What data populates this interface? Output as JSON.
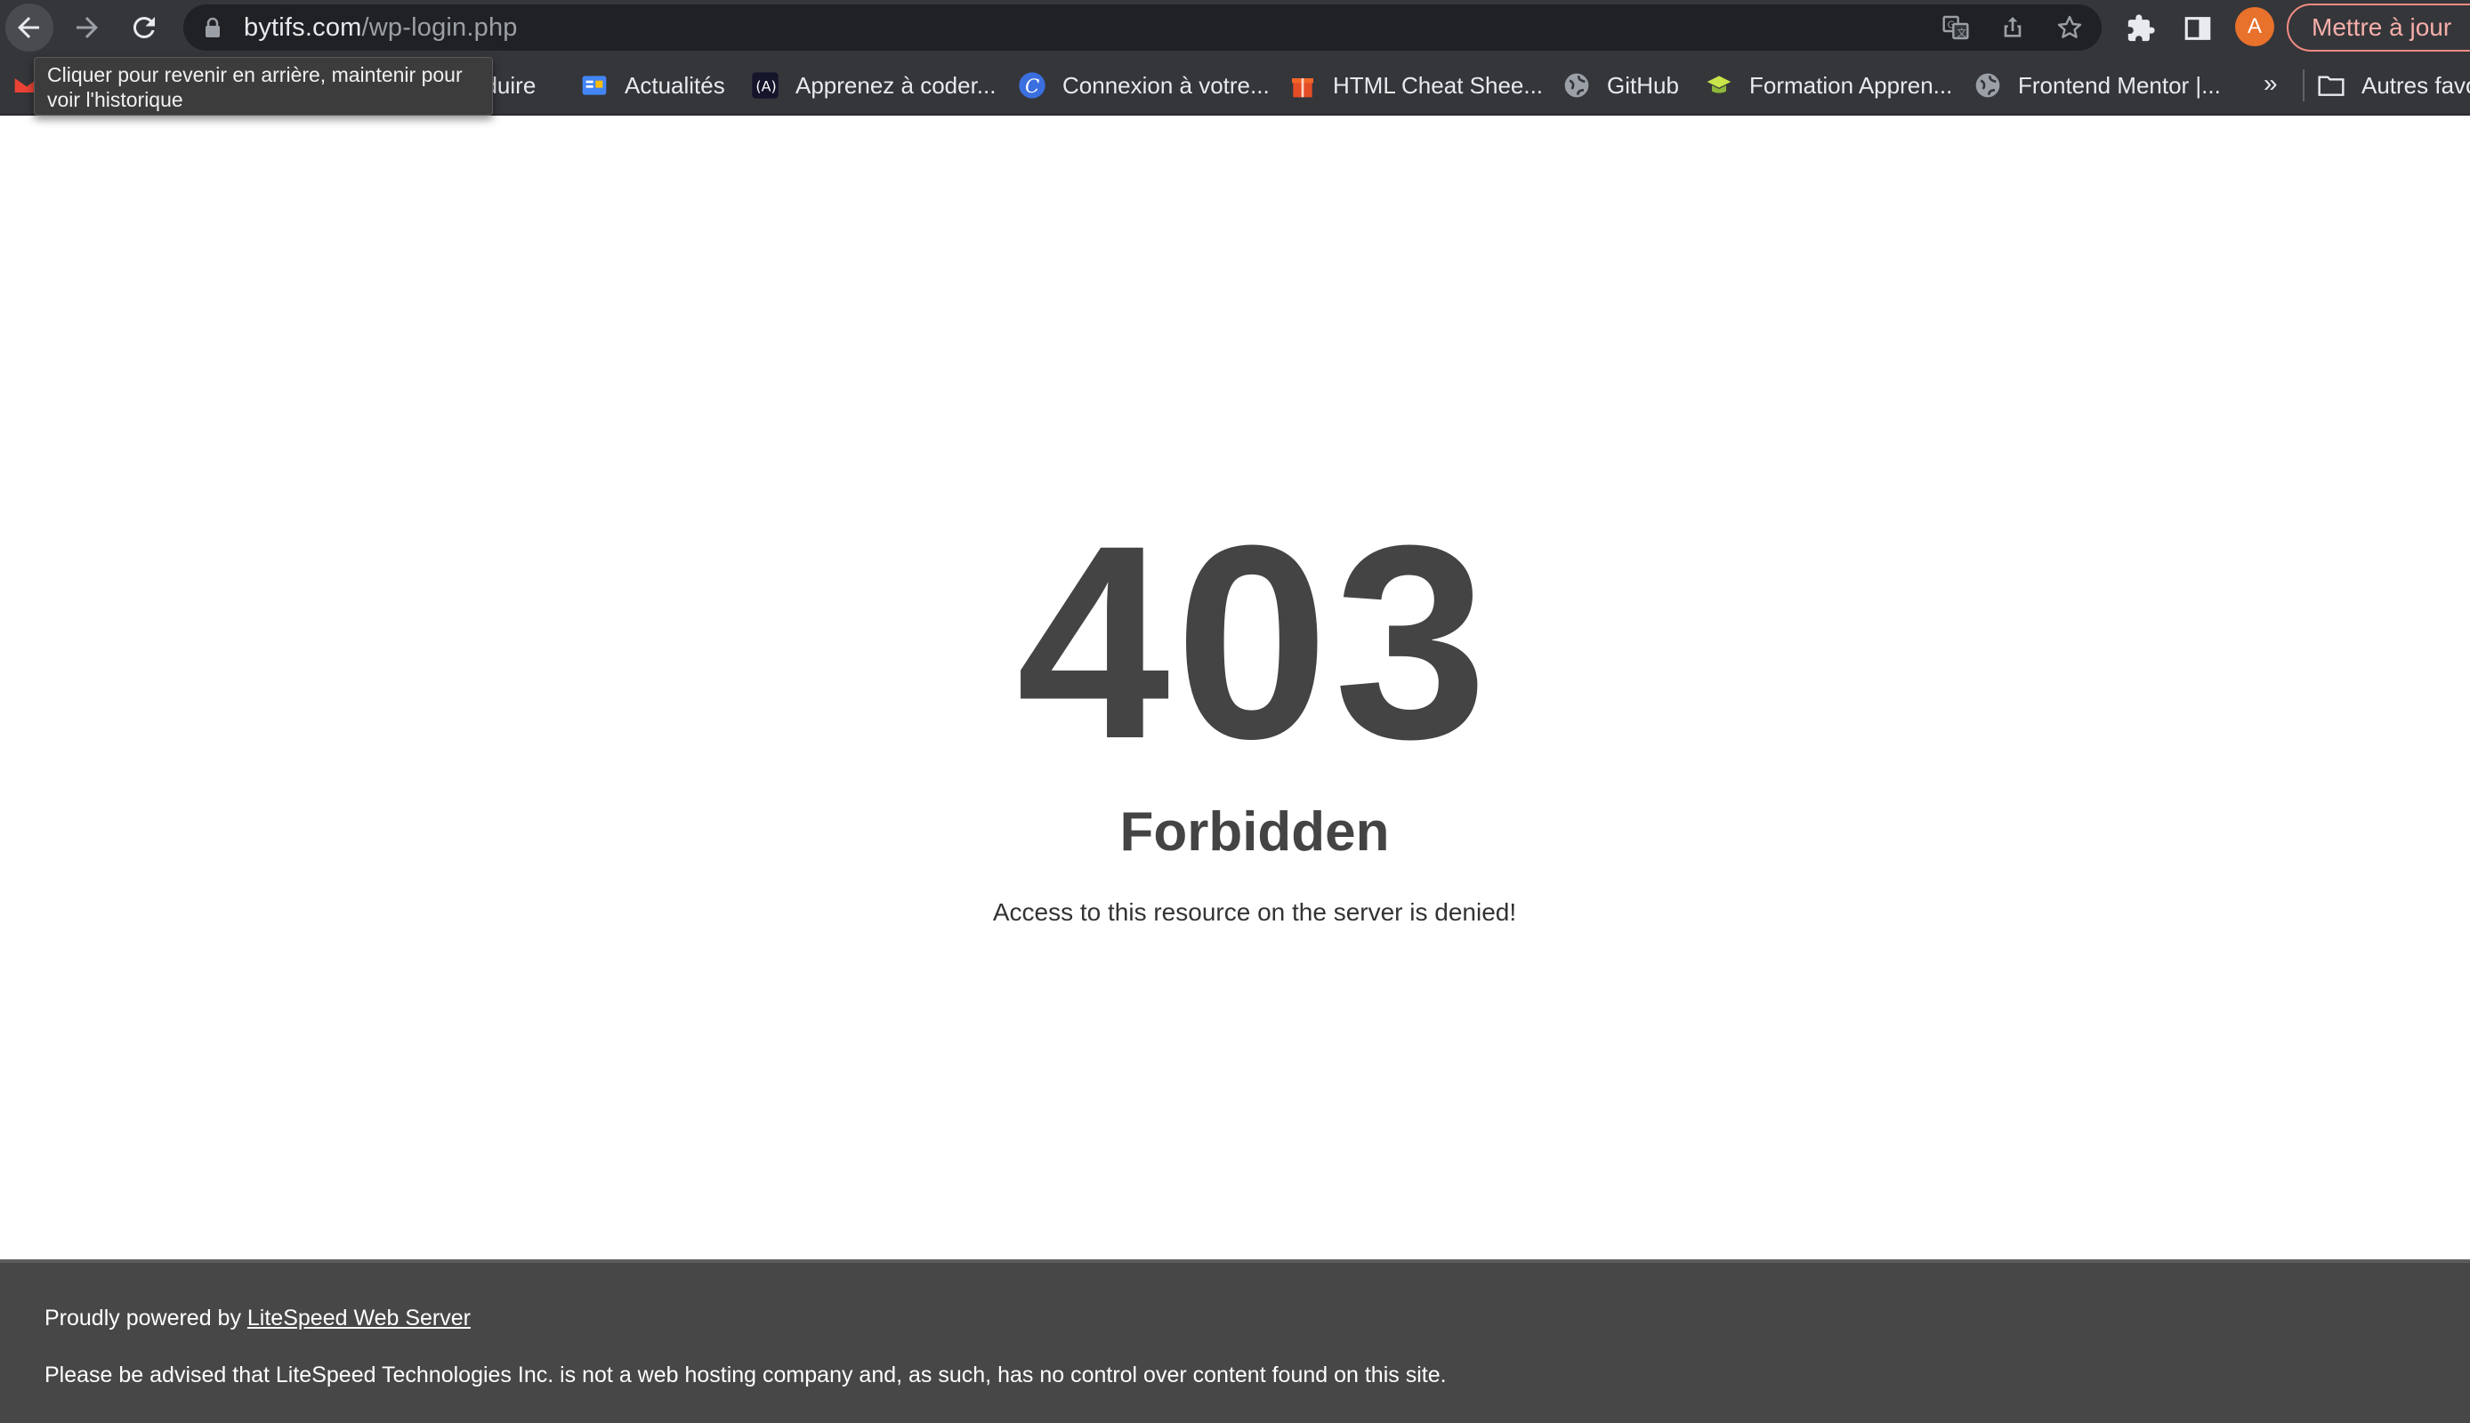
{
  "browser": {
    "url_host": "bytifs.com",
    "url_path": "/wp-login.php",
    "avatar_letter": "A",
    "update_label": "Mettre à jour",
    "tooltip": "Cliquer pour revenir en arrière, maintenir pour voir l'historique",
    "more_bookmarks": "»",
    "icons": {
      "back": "back-arrow-icon",
      "forward": "forward-arrow-icon",
      "reload": "reload-icon",
      "lock": "lock-icon",
      "translate": "translate-icon",
      "share": "share-icon",
      "star": "star-icon",
      "extensions": "puzzle-icon",
      "side_panel": "side-panel-icon",
      "folder": "folder-icon"
    }
  },
  "bookmarks": [
    {
      "label": "aduire",
      "icon": "gmail-icon"
    },
    {
      "label": "Actualités",
      "icon": "google-news-icon"
    },
    {
      "label": "Apprenez à coder...",
      "icon": "code-icon"
    },
    {
      "label": "Connexion à votre...",
      "icon": "c-logo-icon"
    },
    {
      "label": "HTML Cheat Shee...",
      "icon": "html-gift-icon"
    },
    {
      "label": "GitHub",
      "icon": "globe-icon"
    },
    {
      "label": "Formation Appren...",
      "icon": "graduation-icon"
    },
    {
      "label": "Frontend Mentor |...",
      "icon": "globe-icon"
    },
    {
      "label": "Autres favo",
      "icon": "folder-icon"
    }
  ],
  "page": {
    "code": "403",
    "title": "Forbidden",
    "message": "Access to this resource on the server is denied!"
  },
  "footer": {
    "powered_prefix": "Proudly powered by ",
    "powered_link": "LiteSpeed Web Server",
    "disclaimer": "Please be advised that LiteSpeed Technologies Inc. is not a web hosting company and, as such, has no control over content found on this site."
  },
  "colors": {
    "chrome_bg": "#35363a",
    "omnibox_bg": "#202124",
    "text_dark": "#444444",
    "footer_bg": "#474747",
    "avatar_bg": "#e8712b",
    "update_border": "#f28b82"
  }
}
